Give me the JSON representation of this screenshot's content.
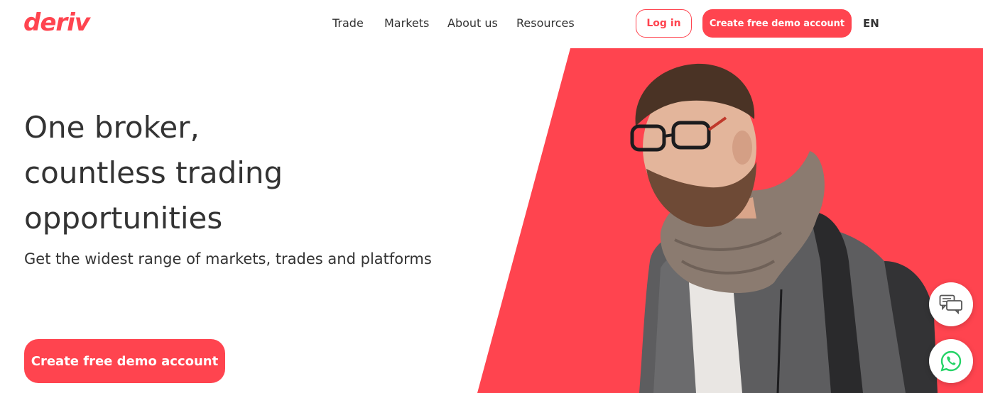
{
  "header": {
    "logo_text": "deriv",
    "nav": [
      {
        "label": "Trade"
      },
      {
        "label": "Markets"
      },
      {
        "label": "About us"
      },
      {
        "label": "Resources"
      }
    ],
    "login_label": "Log in",
    "demo_label": "Create free demo account",
    "language": "EN"
  },
  "hero": {
    "headline_lines": [
      "One broker,",
      "countless trading",
      "opportunities"
    ],
    "subheadline": "Get the widest range of markets, trades and platforms",
    "cta_label": "Create free demo account"
  },
  "floating": {
    "chat_icon": "live-chat-icon",
    "whatsapp_icon": "whatsapp-icon"
  },
  "colors": {
    "brand": "#ff444f",
    "text": "#333333",
    "background": "#ffffff",
    "whatsapp": "#25d366"
  }
}
